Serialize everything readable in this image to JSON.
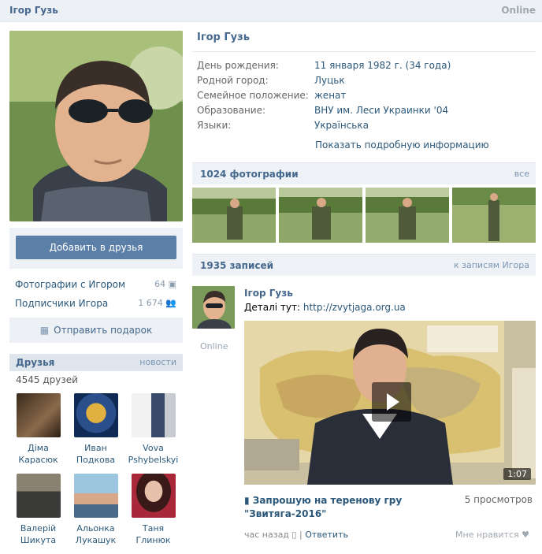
{
  "header": {
    "name": "Ігор Гузь",
    "status": "Online"
  },
  "profile": {
    "add_friend_label": "Добавить в друзья",
    "counters": [
      {
        "label": "Фотографии с Игором",
        "count": "64"
      },
      {
        "label": "Подписчики Игора",
        "count": "1 674"
      }
    ],
    "gift_label": "Отправить подарок",
    "name": "Ігор Гузь",
    "info": [
      {
        "label": "День рождения:",
        "value": "11 января 1982 г. (34 года)"
      },
      {
        "label": "Родной город:",
        "value": "Луцьк"
      },
      {
        "label": "Семейное положение:",
        "value": "женат"
      },
      {
        "label": "Образование:",
        "value": "ВНУ им. Леси Украинки '04"
      },
      {
        "label": "Языки:",
        "value": "Українська"
      }
    ],
    "more_label": "Показать подробную информацию"
  },
  "friends": {
    "title": "Друзья",
    "right_link": "новости",
    "count_text": "4545 друзей",
    "items": [
      {
        "first": "Діма",
        "last": "Карасюк",
        "color": "#5a4330"
      },
      {
        "first": "Иван",
        "last": "Подкова",
        "color": "#3d5f8f"
      },
      {
        "first": "Vova",
        "last": "Pshybelskyi",
        "color": "#b9c2cc"
      },
      {
        "first": "Валерій",
        "last": "Шикута",
        "color": "#6b6250"
      },
      {
        "first": "Альонка",
        "last": "Лукашук",
        "color": "#7aa6c4"
      },
      {
        "first": "Таня",
        "last": "Глинюк",
        "color": "#7a2a30"
      }
    ]
  },
  "photos": {
    "title": "1024 фотографии",
    "right_link": "все"
  },
  "posts": {
    "title": "1935 записей",
    "right_link": "к записям Игора",
    "post": {
      "author": "Ігор Гузь",
      "author_status": "Online",
      "text_prefix": "Деталі тут:",
      "link": "http://zvytjaga.org.ua",
      "video_duration": "1:07",
      "video_title": "Запрошую на теренову гру \"Звитяга-2016\"",
      "views": "5 просмотров",
      "time": "час назад",
      "reply_label": "Ответить",
      "likes_label": "Мне нравится"
    }
  }
}
